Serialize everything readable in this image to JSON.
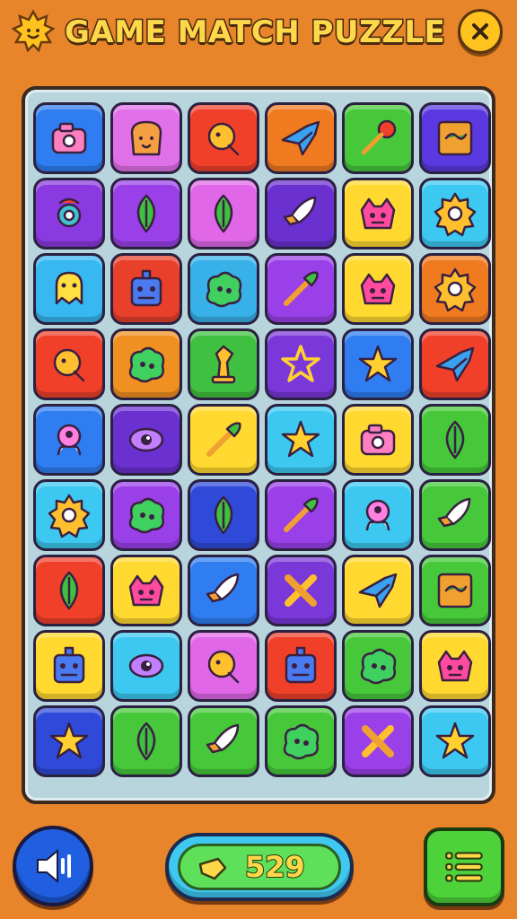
{
  "header": {
    "title": "GAME MATCH PUZZLE",
    "logo_icon": "smiling-sun-icon",
    "close_icon": "close-icon"
  },
  "board": {
    "rows": [
      [
        {
          "color": "#2f7df0",
          "icon": "camera-icon"
        },
        {
          "color": "#e070e8",
          "icon": "toast-icon"
        },
        {
          "color": "#f0402a",
          "icon": "bubble-icon"
        },
        {
          "color": "#f07a20",
          "icon": "fish-icon"
        },
        {
          "color": "#46c83a",
          "icon": "lollipop-icon"
        },
        {
          "color": "#5a3ae0",
          "icon": "frame-icon"
        }
      ],
      [
        {
          "color": "#8a3ae0",
          "icon": "eye-flower-icon"
        },
        {
          "color": "#9a40e8",
          "icon": "leaf-icon"
        },
        {
          "color": "#e068e8",
          "icon": "leaf-icon"
        },
        {
          "color": "#6a30d0",
          "icon": "rocket-icon"
        },
        {
          "color": "#ffd830",
          "icon": "monster-icon"
        },
        {
          "color": "#3cc8f0",
          "icon": "gear-icon"
        }
      ],
      [
        {
          "color": "#38b8f0",
          "icon": "ghost-icon"
        },
        {
          "color": "#e8402a",
          "icon": "robot-icon"
        },
        {
          "color": "#38b0e8",
          "icon": "blob-icon"
        },
        {
          "color": "#9a40e8",
          "icon": "brush-icon"
        },
        {
          "color": "#ffd830",
          "icon": "monster-icon"
        },
        {
          "color": "#f07a20",
          "icon": "gear-icon"
        }
      ],
      [
        {
          "color": "#f0402a",
          "icon": "bubble-icon"
        },
        {
          "color": "#f09020",
          "icon": "blob-icon"
        },
        {
          "color": "#40c040",
          "icon": "chess-piece-icon"
        },
        {
          "color": "#7a38d8",
          "icon": "star-outline-icon"
        },
        {
          "color": "#2f7df0",
          "icon": "star-icon"
        },
        {
          "color": "#f0402a",
          "icon": "fish-icon"
        }
      ],
      [
        {
          "color": "#2f7df0",
          "icon": "alien-icon"
        },
        {
          "color": "#6a30d0",
          "icon": "eye-icon"
        },
        {
          "color": "#ffd830",
          "icon": "brush-icon"
        },
        {
          "color": "#3cc8f0",
          "icon": "star-icon"
        },
        {
          "color": "#ffd830",
          "icon": "camera-icon"
        },
        {
          "color": "#46c83a",
          "icon": "leaf-icon"
        }
      ],
      [
        {
          "color": "#3cc8f0",
          "icon": "gear-icon"
        },
        {
          "color": "#9a40e8",
          "icon": "blob-icon"
        },
        {
          "color": "#2f4ad8",
          "icon": "leaf-icon"
        },
        {
          "color": "#9a40e8",
          "icon": "brush-icon"
        },
        {
          "color": "#3cc8f0",
          "icon": "alien-icon"
        },
        {
          "color": "#46c83a",
          "icon": "rocket-icon"
        }
      ],
      [
        {
          "color": "#f0402a",
          "icon": "leaf-icon"
        },
        {
          "color": "#ffd830",
          "icon": "monster-icon"
        },
        {
          "color": "#2f7df0",
          "icon": "rocket-icon"
        },
        {
          "color": "#7a38d8",
          "icon": "bone-icon"
        },
        {
          "color": "#ffd830",
          "icon": "fish-icon"
        },
        {
          "color": "#46c83a",
          "icon": "frame-icon"
        }
      ],
      [
        {
          "color": "#ffd830",
          "icon": "robot-icon"
        },
        {
          "color": "#3cc8f0",
          "icon": "eye-icon"
        },
        {
          "color": "#e068e8",
          "icon": "bubble-icon"
        },
        {
          "color": "#f0402a",
          "icon": "robot-icon"
        },
        {
          "color": "#46c83a",
          "icon": "blob-icon"
        },
        {
          "color": "#ffd830",
          "icon": "monster-icon"
        }
      ],
      [
        {
          "color": "#2f4ad8",
          "icon": "star-icon"
        },
        {
          "color": "#46c83a",
          "icon": "leaf-icon"
        },
        {
          "color": "#46c83a",
          "icon": "rocket-icon"
        },
        {
          "color": "#46c83a",
          "icon": "blob-icon"
        },
        {
          "color": "#9a40e8",
          "icon": "bone-icon"
        },
        {
          "color": "#3cc8f0",
          "icon": "star-icon"
        }
      ]
    ]
  },
  "footer": {
    "sound_icon": "speaker-icon",
    "score_icon": "flag-icon",
    "score_value": "529",
    "menu_icon": "menu-icon"
  }
}
